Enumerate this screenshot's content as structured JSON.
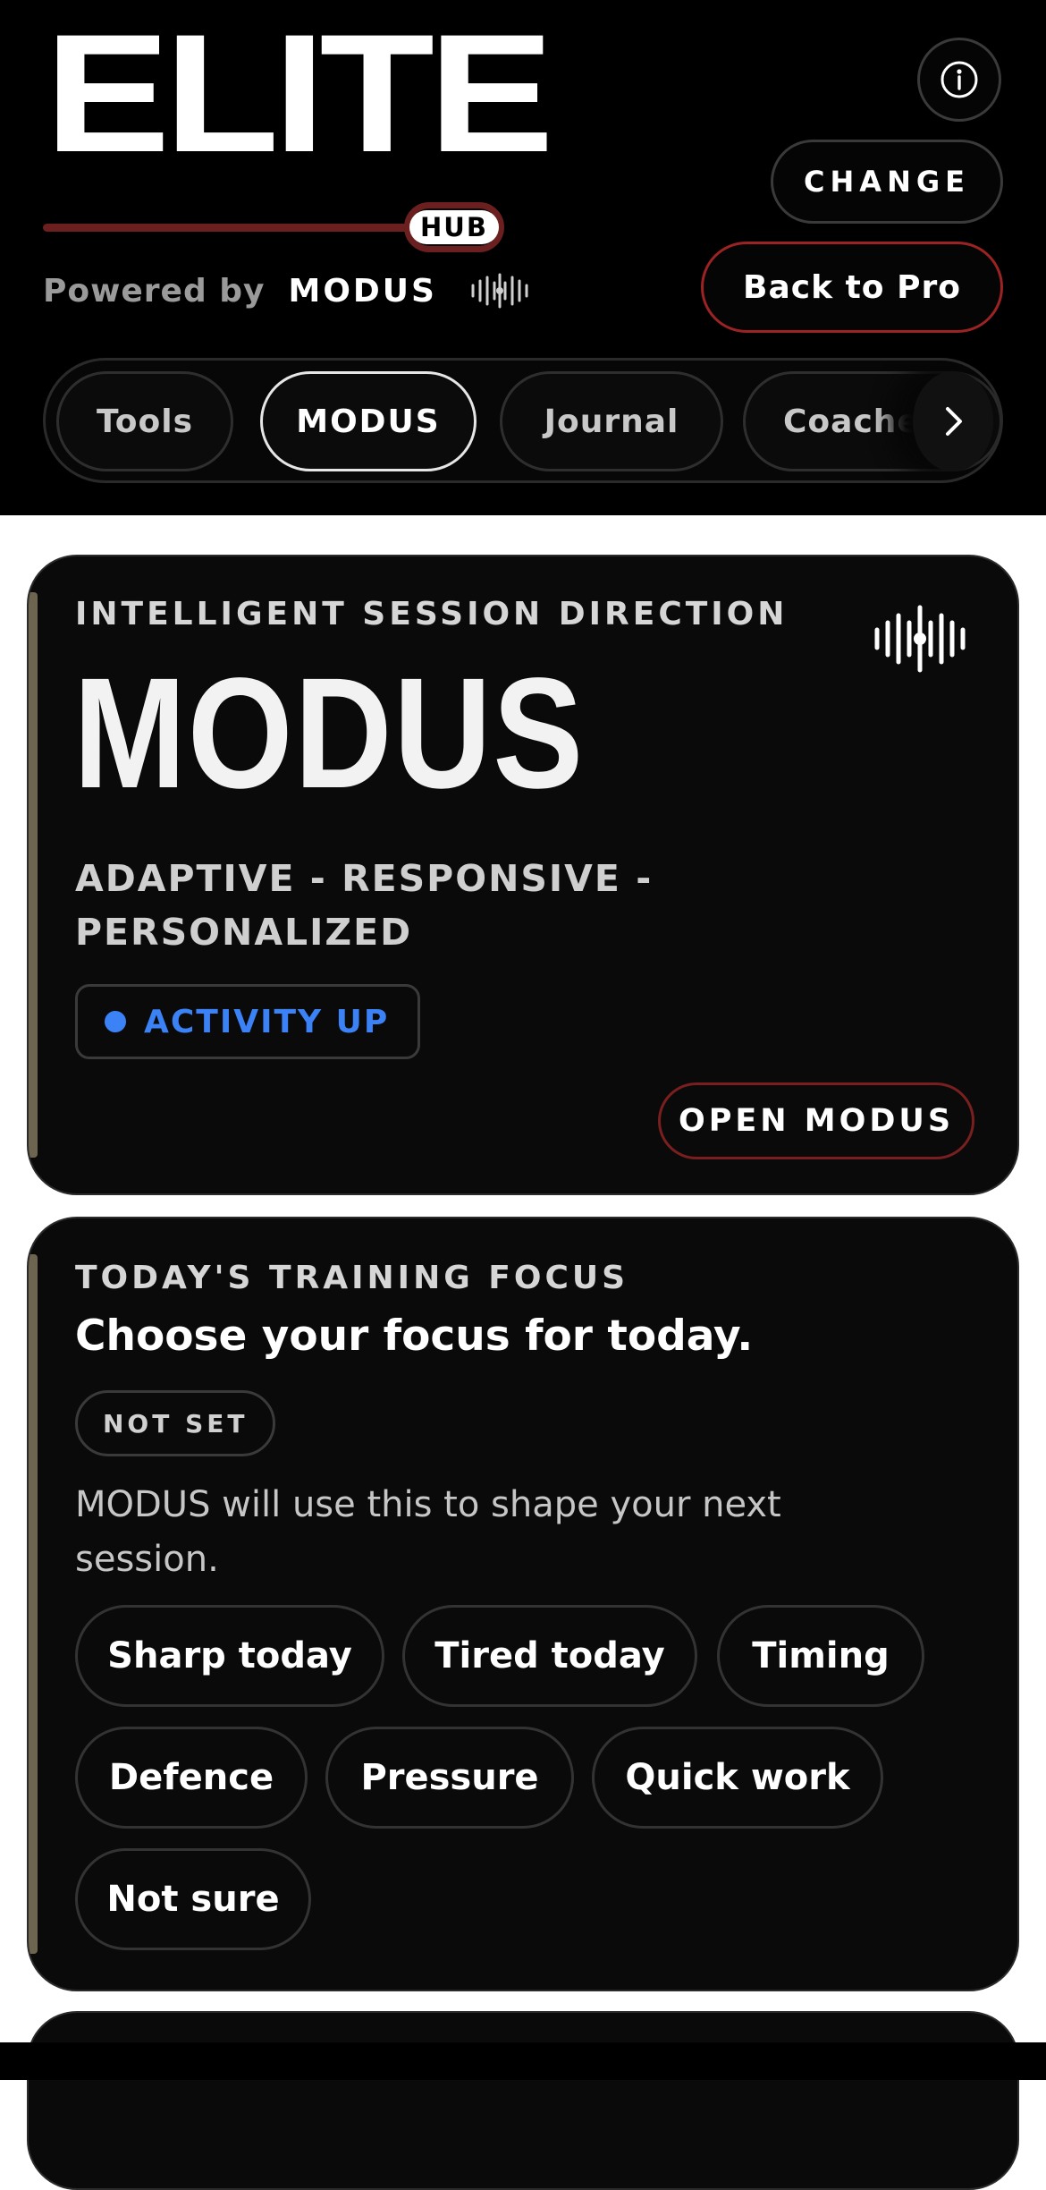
{
  "header": {
    "brand": "ELITE",
    "hub_label": "HUB",
    "powered_by": "Powered by",
    "powered_brand": "MODUS",
    "change_label": "CHANGE",
    "back_label": "Back to Pro",
    "tabs": [
      {
        "label": "Tools",
        "active": false
      },
      {
        "label": "MODUS",
        "active": true
      },
      {
        "label": "Journal",
        "active": false
      },
      {
        "label": "Coaches",
        "active": false
      }
    ]
  },
  "modus_card": {
    "eyebrow": "INTELLIGENT SESSION DIRECTION",
    "title": "MODUS",
    "tagline": "ADAPTIVE  -  RESPONSIVE  -  PERSONALIZED",
    "status": "ACTIVITY UP",
    "status_color": "#3b82f6",
    "open_label": "OPEN MODUS"
  },
  "focus_card": {
    "eyebrow": "TODAY'S TRAINING FOCUS",
    "heading": "Choose your focus for today.",
    "state_badge": "NOT SET",
    "description": "MODUS will use this to shape your next session.",
    "options": [
      "Sharp today",
      "Tired today",
      "Timing",
      "Defence",
      "Pressure",
      "Quick work",
      "Not sure"
    ]
  },
  "colors": {
    "accent_red": "#9b2323",
    "card_bg": "#0a0a0a",
    "card_accent": "#6e6550"
  }
}
